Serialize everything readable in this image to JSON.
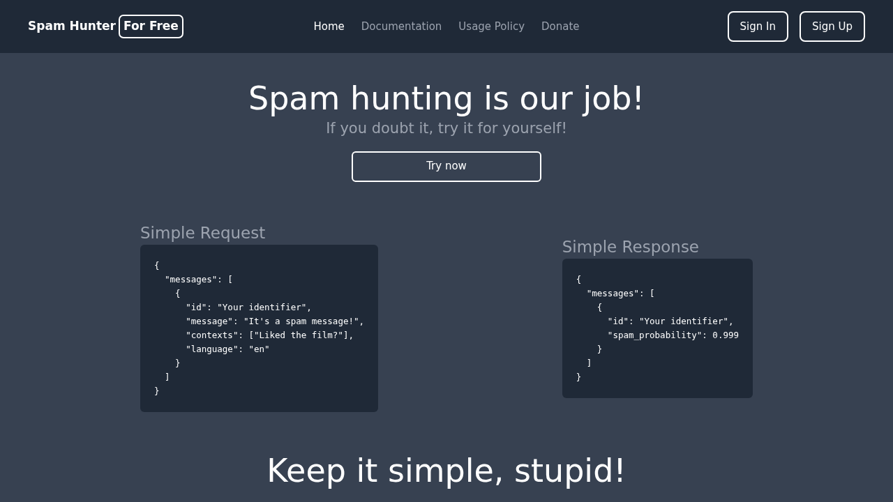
{
  "brand": {
    "name": "Spam Hunter",
    "badge": "For Free"
  },
  "nav": [
    {
      "label": "Home",
      "selected": true
    },
    {
      "label": "Documentation",
      "selected": false
    },
    {
      "label": "Usage Policy",
      "selected": false
    },
    {
      "label": "Donate",
      "selected": false
    }
  ],
  "auth_buttons": [
    "Sign In",
    "Sign Up"
  ],
  "hero": {
    "title": "Spam hunting is our job!",
    "subtitle": "If you doubt it, try it for yourself!",
    "button": "Try now"
  },
  "examples": [
    {
      "title": "Simple Request",
      "code": [
        "{",
        "  \"messages\": [",
        "    {",
        "      \"id\": \"Your identifier\",",
        "      \"message\": \"It's a spam message!\",",
        "      \"contexts\": [\"Liked the film?\"],",
        "      \"language\": \"en\"",
        "    }",
        "  ]",
        "}"
      ]
    },
    {
      "title": "Simple Response",
      "code": [
        "{",
        "  \"messages\": [",
        "    {",
        "      \"id\": \"Your identifier\",",
        "      \"spam_probability\": 0.999",
        "    }",
        "  ]",
        "}"
      ]
    }
  ],
  "section_title": "Keep it simple, stupid!"
}
